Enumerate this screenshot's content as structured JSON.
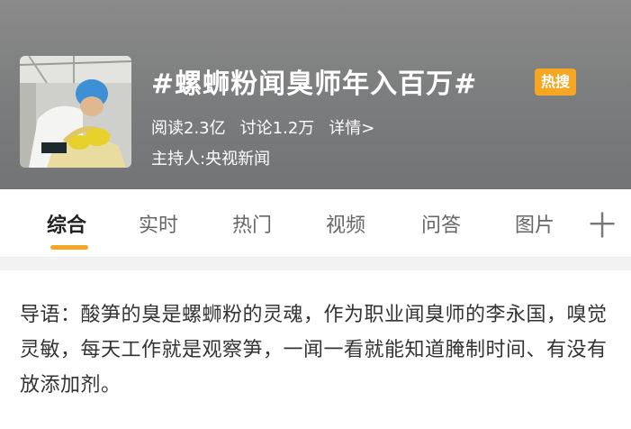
{
  "topic": {
    "title": "#螺蛳粉闻臭师年入百万#",
    "badge": "热搜",
    "reads_label": "阅读2.3亿",
    "discussions_label": "讨论1.2万",
    "details_link": "详情>",
    "host_label": "主持人: ",
    "host_name": "央视新闻"
  },
  "tabs": [
    {
      "label": "综合",
      "active": true
    },
    {
      "label": "实时"
    },
    {
      "label": "热门"
    },
    {
      "label": "视频"
    },
    {
      "label": "问答"
    },
    {
      "label": "图片"
    }
  ],
  "add_tab_glyph": "十",
  "intro": {
    "text": "导语：酸笋的臭是螺蛳粉的灵魂，作为职业闻臭师的李永国，嗅觉灵敏，每天工作就是观察笋，一闻一看就能知道腌制时间、有没有放添加剂。"
  },
  "colors": {
    "accent": "#f5a623",
    "header_bg": "#7b7c7d"
  }
}
